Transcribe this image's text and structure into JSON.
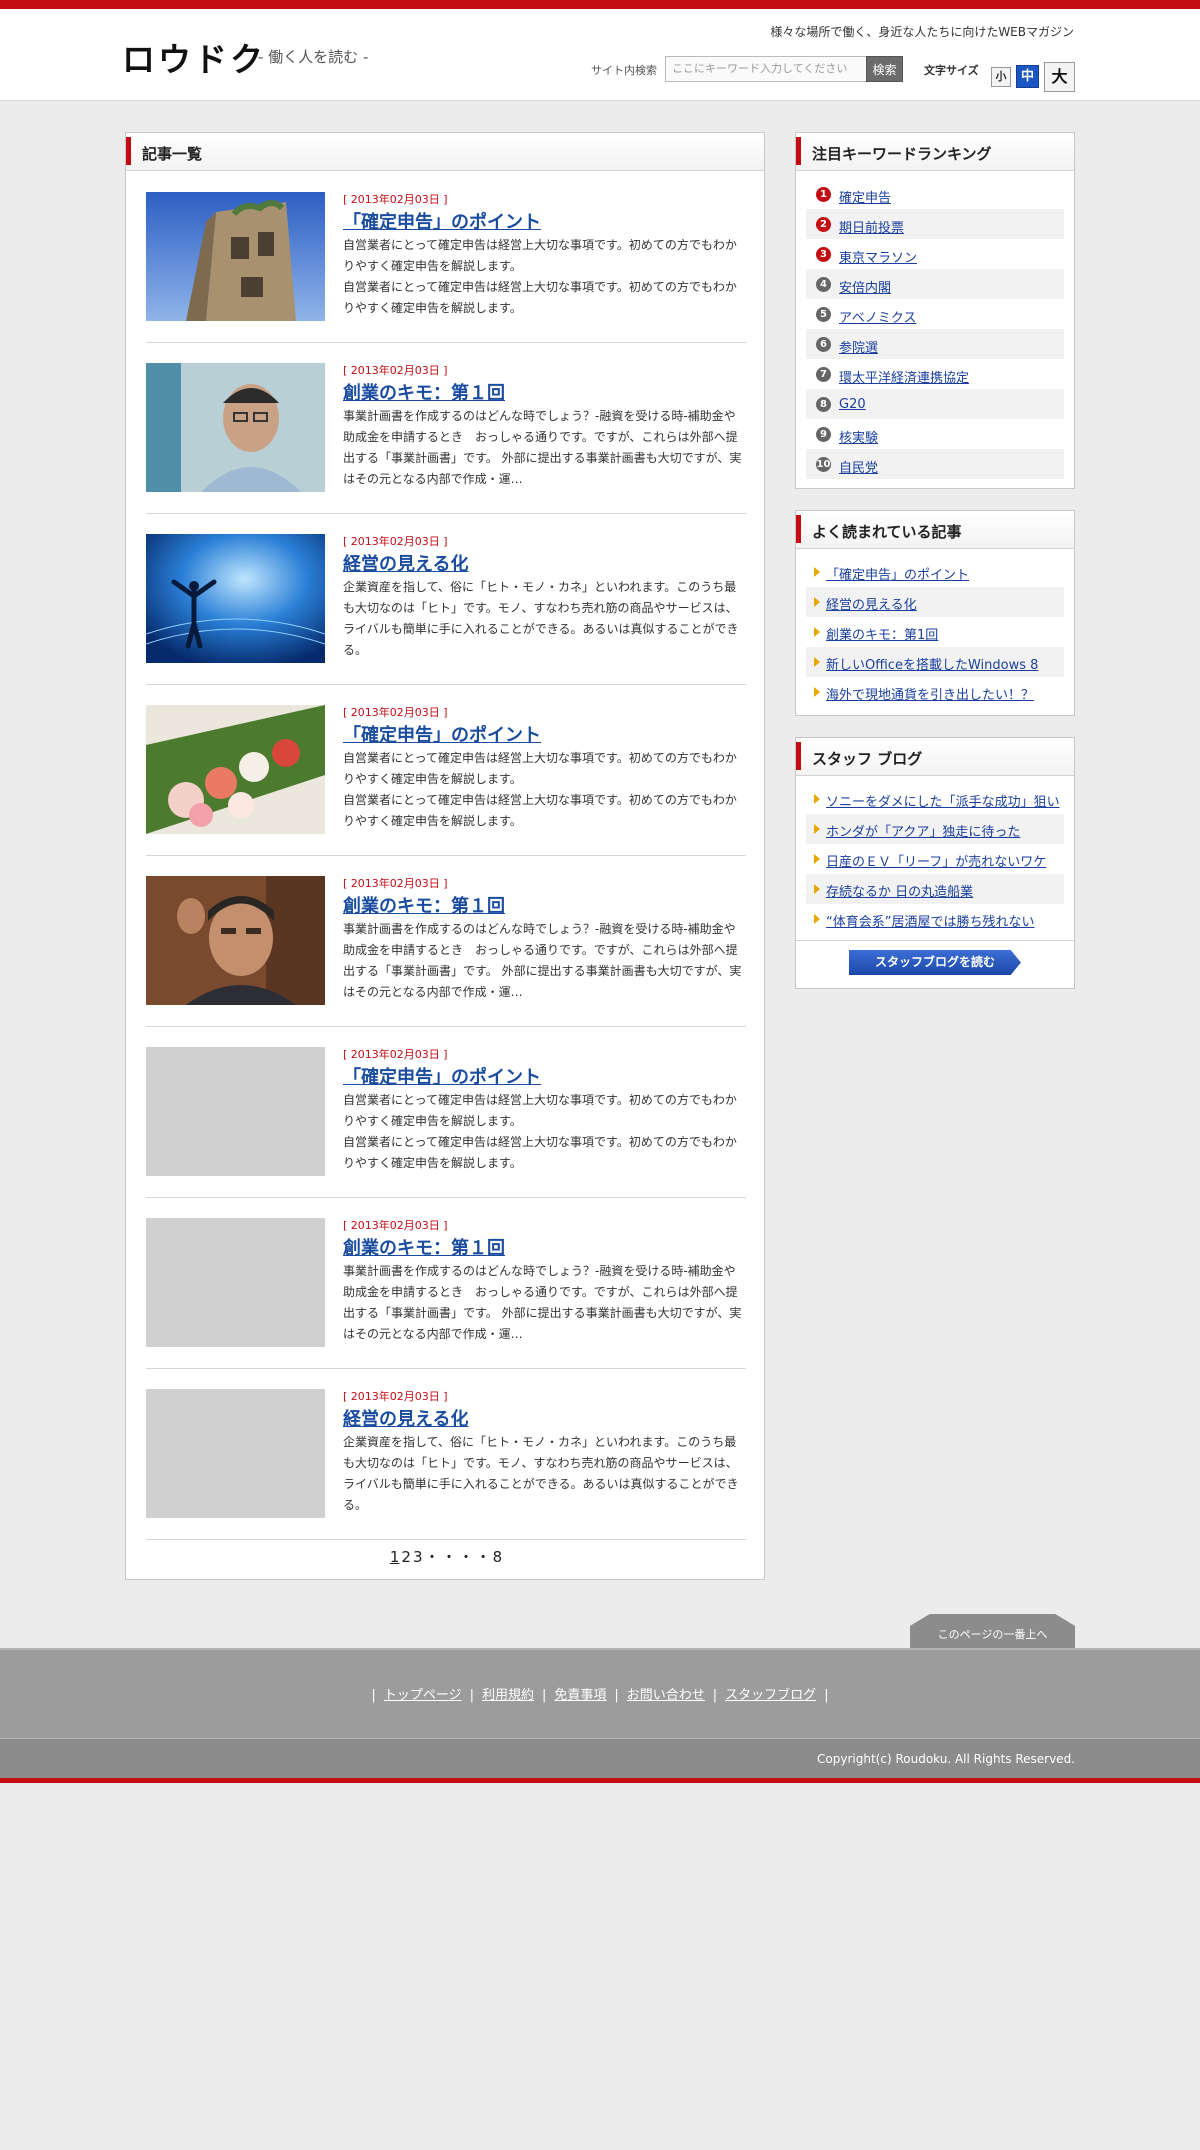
{
  "header": {
    "logo": "ロウドク",
    "subtitle": "- 働く人を読む -",
    "tagline": "様々な場所で働く、身近な人たちに向けたWEBマガジン",
    "search_label": "サイト内検索",
    "search_placeholder": "ここにキーワード入力してください",
    "search_button": "検索",
    "fontsize_label": "文字サイズ",
    "fontsize_small": "小",
    "fontsize_medium": "中",
    "fontsize_large": "大"
  },
  "main": {
    "heading": "記事一覧",
    "articles": [
      {
        "date": "[ 2013年02月03日 ]",
        "title": "「確定申告」のポイント",
        "excerpt": "自営業者にとって確定申告は経営上大切な事項です。初めての方でもわかりやすく確定申告を解説します。\n自営業者にとって確定申告は経営上大切な事項です。初めての方でもわかりやすく確定申告を解説します。",
        "thumb": "building-photo"
      },
      {
        "date": "[ 2013年02月03日 ]",
        "title": "創業のキモ：第１回",
        "excerpt": "事業計画書を作成するのはどんな時でしょう？-融資を受ける時-補助金や助成金を申請するとき　おっしゃる通りです。ですが、これらは外部へ提出する「事業計画書」です。 外部に提出する事業計画書も大切ですが、実はその元となる内部で作成・運…",
        "thumb": "man-glasses-photo"
      },
      {
        "date": "[ 2013年02月03日 ]",
        "title": "経営の見える化",
        "excerpt": "企業資産を指して、俗に「ヒト・モノ・カネ」といわれます。このうち最も大切なのは「ヒト」です。モノ、すなわち売れ筋の商品やサービスは、ライバルも簡単に手に入れることができる。あるいは真似することができる。",
        "thumb": "silhouette-photo"
      },
      {
        "date": "[ 2013年02月03日 ]",
        "title": "「確定申告」のポイント",
        "excerpt": "自営業者にとって確定申告は経営上大切な事項です。初めての方でもわかりやすく確定申告を解説します。\n自営業者にとって確定申告は経営上大切な事項です。初めての方でもわかりやすく確定申告を解説します。",
        "thumb": "sushi-photo"
      },
      {
        "date": "[ 2013年02月03日 ]",
        "title": "創業のキモ：第１回",
        "excerpt": "事業計画書を作成するのはどんな時でしょう？-融資を受ける時-補助金や助成金を申請するとき　おっしゃる通りです。ですが、これらは外部へ提出する「事業計画書」です。 外部に提出する事業計画書も大切ですが、実はその元となる内部で作成・運…",
        "thumb": "businessman-photo"
      },
      {
        "date": "[ 2013年02月03日 ]",
        "title": "「確定申告」のポイント",
        "excerpt": "自営業者にとって確定申告は経営上大切な事項です。初めての方でもわかりやすく確定申告を解説します。\n自営業者にとって確定申告は経営上大切な事項です。初めての方でもわかりやすく確定申告を解説します。",
        "thumb": "placeholder"
      },
      {
        "date": "[ 2013年02月03日 ]",
        "title": "創業のキモ：第１回",
        "excerpt": "事業計画書を作成するのはどんな時でしょう？-融資を受ける時-補助金や助成金を申請するとき　おっしゃる通りです。ですが、これらは外部へ提出する「事業計画書」です。 外部に提出する事業計画書も大切ですが、実はその元となる内部で作成・運…",
        "thumb": "placeholder"
      },
      {
        "date": "[ 2013年02月03日 ]",
        "title": "経営の見える化",
        "excerpt": "企業資産を指して、俗に「ヒト・モノ・カネ」といわれます。このうち最も大切なのは「ヒト」です。モノ、すなわち売れ筋の商品やサービスは、ライバルも簡単に手に入れることができる。あるいは真似することができる。",
        "thumb": "placeholder"
      }
    ],
    "pagination": [
      "1",
      "2",
      "3",
      "・",
      "・",
      "・",
      "・",
      "8"
    ]
  },
  "sidebar": {
    "ranking_heading": "注目キーワードランキング",
    "ranking": [
      {
        "num": "1",
        "label": "確定申告"
      },
      {
        "num": "2",
        "label": "期日前投票"
      },
      {
        "num": "3",
        "label": "東京マラソン"
      },
      {
        "num": "4",
        "label": "安倍内閣"
      },
      {
        "num": "5",
        "label": "アベノミクス"
      },
      {
        "num": "6",
        "label": "参院選"
      },
      {
        "num": "7",
        "label": "環太平洋経済連携協定"
      },
      {
        "num": "8",
        "label": "G20"
      },
      {
        "num": "9",
        "label": "核実験"
      },
      {
        "num": "10",
        "label": "自民党"
      }
    ],
    "popular_heading": "よく読まれている記事",
    "popular": [
      "「確定申告」のポイント",
      "経営の見える化",
      "創業のキモ：第1回",
      "新しいOfficeを搭載したWindows 8",
      "海外で現地通貨を引き出したい！？"
    ],
    "blog_heading": "スタッフ ブログ",
    "blog": [
      "ソニーをダメにした「派手な成功」狙い",
      "ホンダが「アクア」独走に待った",
      "日産のＥＶ「リーフ」が売れないワケ",
      "存続なるか 日の丸造船業",
      "“体育会系”居酒屋では勝ち残れない"
    ],
    "blog_button": "スタッフブログを読む"
  },
  "footer": {
    "page_top": "このページの一番上へ",
    "links": [
      "トップページ",
      "利用規約",
      "免責事項",
      "お問い合わせ",
      "スタッフブログ"
    ],
    "copyright": "Copyright(c) Roudoku. All Rights Reserved."
  },
  "colors": {
    "accent_red": "#c30d13",
    "link_blue": "#1a3f9e",
    "button_blue": "#1b48a8"
  }
}
